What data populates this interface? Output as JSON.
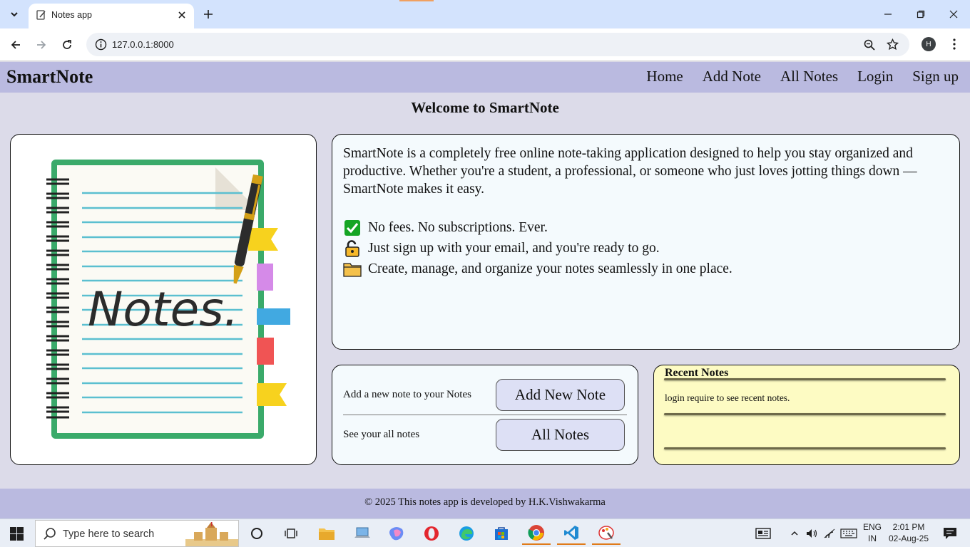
{
  "browser": {
    "tab_title": "Notes app",
    "url": "127.0.0.1:8000",
    "profile_initial": "H"
  },
  "site": {
    "brand": "SmartNote",
    "nav": [
      "Home",
      "Add Note",
      "All Notes",
      "Login",
      "Sign up"
    ],
    "welcome": "Welcome to SmartNote",
    "about": "SmartNote is a completely free online note-taking application designed to help you stay organized and productive. Whether you're a student, a professional, or someone who just loves jotting things down — SmartNote makes it easy.",
    "features": [
      {
        "icon": "check-mark-icon",
        "text": "No fees. No subscriptions. Ever."
      },
      {
        "icon": "unlocked-lock-icon",
        "text": "Just sign up with your email, and you're ready to go."
      },
      {
        "icon": "folder-icon",
        "text": "Create, manage, and organize your notes seamlessly in one place."
      }
    ],
    "image_text": "Notes.",
    "actions": [
      {
        "label": "Add a new note to your Notes",
        "button": "Add New Note"
      },
      {
        "label": "See your all notes",
        "button": "All Notes"
      }
    ],
    "recent": {
      "title": "Recent Notes",
      "message": "login require to see recent notes."
    },
    "footer": "© 2025 This notes app is developed by H.K.Vishwakarma"
  },
  "taskbar": {
    "search_placeholder": "Type here to search",
    "lang_top": "ENG",
    "lang_bottom": "IN",
    "time": "2:01 PM",
    "date": "02-Aug-25"
  }
}
